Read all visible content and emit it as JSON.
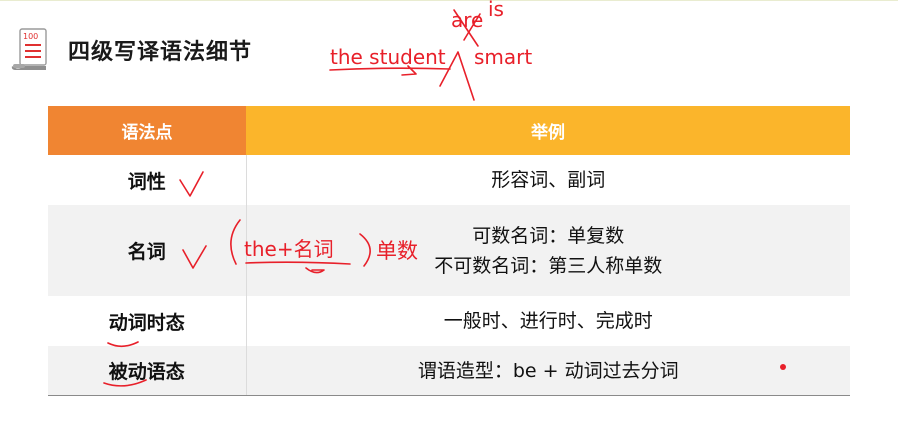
{
  "header": {
    "title": "四级写译语法细节"
  },
  "table": {
    "headers": [
      "语法点",
      "举例"
    ],
    "rows": [
      {
        "point": "词性",
        "examples": [
          "形容词、副词"
        ]
      },
      {
        "point": "名词",
        "examples": [
          "可数名词：单复数",
          "不可数名词：第三人称单数"
        ]
      },
      {
        "point": "动词时态",
        "examples": [
          "一般时、进行时、完成时"
        ]
      },
      {
        "point": "被动语态",
        "examples": [
          "谓语造型：be + 动词过去分词"
        ]
      }
    ]
  },
  "annotations": {
    "sentence_subject": "the student",
    "sentence_adjective": "smart",
    "verb_crossed": "are",
    "verb_correct": "is",
    "noun_note": "the+名词",
    "singular_note": "单数"
  },
  "colors": {
    "header_left": "#f08532",
    "header_right": "#fbb52b",
    "annotation": "#e8202a",
    "row_alt": "#f2f2f2"
  }
}
